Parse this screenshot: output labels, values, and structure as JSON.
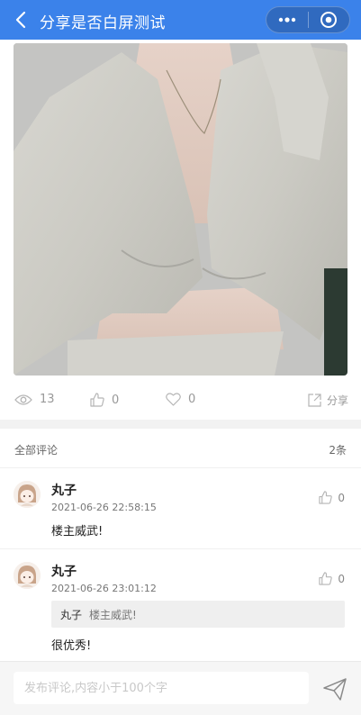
{
  "nav": {
    "title": "分享是否白屏测试",
    "back_icon": "chevron-left-icon",
    "more_icon": "more-dots-icon",
    "close_icon": "target-close-icon",
    "bar_color": "#3b82ea"
  },
  "post": {
    "image_icon": "photo-image"
  },
  "stats": {
    "views": "13",
    "likes": "0",
    "favorites": "0",
    "share_label": "分享"
  },
  "comments_header": {
    "title": "全部评论",
    "count": "2条"
  },
  "comments": [
    {
      "name": "丸子",
      "time": "2021-06-26 22:58:15",
      "likes": "0",
      "body": "楼主威武!"
    },
    {
      "name": "丸子",
      "time": "2021-06-26 23:01:12",
      "likes": "0",
      "quote_name": "丸子",
      "quote_text": "楼主威武!",
      "body": "很优秀!"
    }
  ],
  "input": {
    "placeholder": "发布评论,内容小于100个字"
  },
  "colors": {
    "accent": "#3b82ea",
    "muted": "#999999"
  }
}
